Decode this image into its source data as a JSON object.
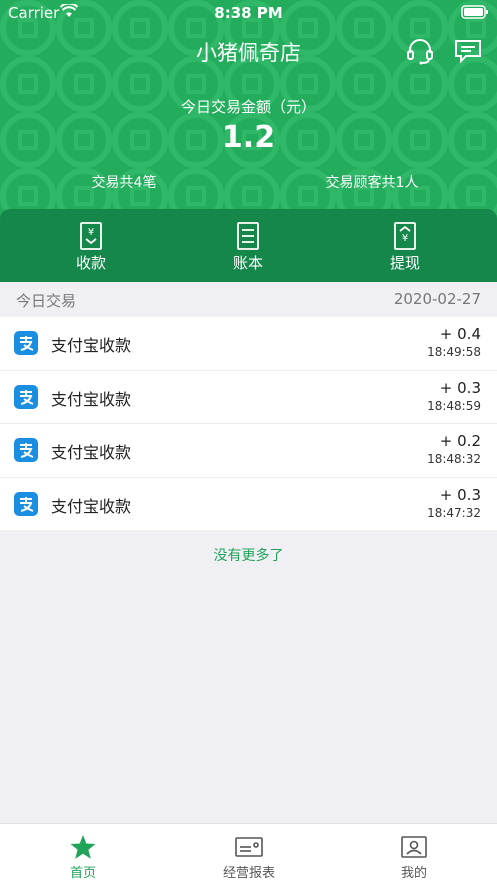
{
  "status_bar": {
    "carrier": "Carrier",
    "time": "8:38 PM"
  },
  "header": {
    "title": "小猪佩奇店",
    "icons": [
      "headset-icon",
      "message-icon"
    ]
  },
  "summary": {
    "amount_label": "今日交易金额（元）",
    "amount_value": "1.2",
    "count_text": "交易共4笔",
    "customers_text": "交易顾客共1人"
  },
  "actions": [
    {
      "label": "收款",
      "icon": "receive-money-icon"
    },
    {
      "label": "账本",
      "icon": "ledger-icon"
    },
    {
      "label": "提现",
      "icon": "withdraw-icon"
    }
  ],
  "section": {
    "title": "今日交易",
    "date": "2020-02-27"
  },
  "transactions": [
    {
      "name": "支付宝收款",
      "amount": "+ 0.4",
      "time": "18:49:58"
    },
    {
      "name": "支付宝收款",
      "amount": "+ 0.3",
      "time": "18:48:59"
    },
    {
      "name": "支付宝收款",
      "amount": "+ 0.2",
      "time": "18:48:32"
    },
    {
      "name": "支付宝收款",
      "amount": "+ 0.3",
      "time": "18:47:32"
    }
  ],
  "footer": {
    "no_more": "没有更多了"
  },
  "tabs": [
    {
      "label": "首页",
      "icon": "star-icon",
      "active": true
    },
    {
      "label": "经营报表",
      "icon": "report-icon",
      "active": false
    },
    {
      "label": "我的",
      "icon": "profile-icon",
      "active": false
    }
  ],
  "colors": {
    "brand": "#22ac5c",
    "brand_dark": "#16874a",
    "alipay": "#1a8ee1"
  }
}
